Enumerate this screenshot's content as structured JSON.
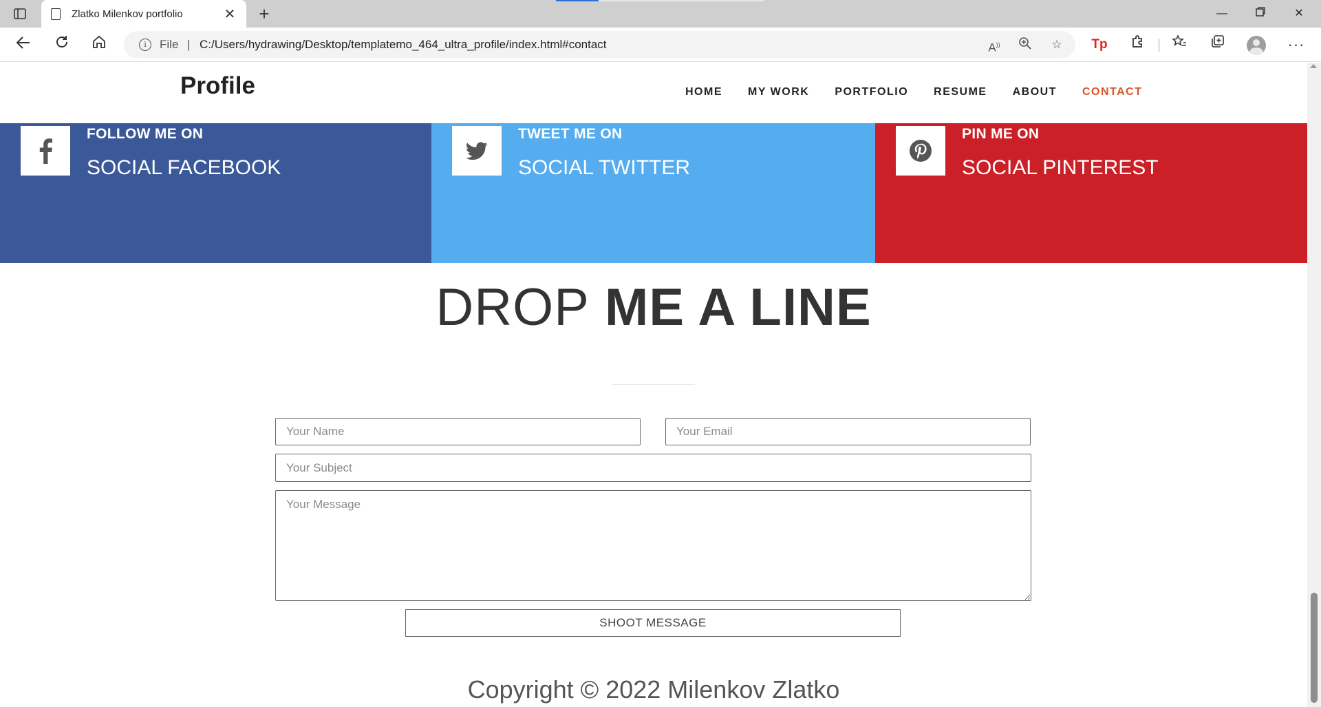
{
  "browser": {
    "tab_title": "Zlatko Milenkov portfolio",
    "address_scheme": "File",
    "address_url": "C:/Users/hydrawing/Desktop/templatemo_464_ultra_profile/index.html#contact"
  },
  "site": {
    "logo": "Profile",
    "nav": [
      {
        "label": "HOME",
        "active": false
      },
      {
        "label": "MY WORK",
        "active": false
      },
      {
        "label": "PORTFOLIO",
        "active": false
      },
      {
        "label": "RESUME",
        "active": false
      },
      {
        "label": "ABOUT",
        "active": false
      },
      {
        "label": "CONTACT",
        "active": true
      }
    ],
    "active_color": "#d9532c"
  },
  "social": [
    {
      "small": "FOLLOW ME ON",
      "big": "SOCIAL FACEBOOK",
      "icon": "facebook-icon",
      "color": "#3b5998"
    },
    {
      "small": "TWEET ME ON",
      "big": "SOCIAL TWITTER",
      "icon": "twitter-icon",
      "color": "#55acee"
    },
    {
      "small": "PIN ME ON",
      "big": "SOCIAL PINTEREST",
      "icon": "pinterest-icon",
      "color": "#cb2027"
    }
  ],
  "contact": {
    "heading_light": "DROP",
    "heading_bold": "ME A LINE",
    "name_placeholder": "Your Name",
    "email_placeholder": "Your Email",
    "subject_placeholder": "Your Subject",
    "message_placeholder": "Your Message",
    "submit_label": "SHOOT MESSAGE"
  },
  "footer": {
    "copyright": "Copyright © 2022 Milenkov Zlatko"
  }
}
